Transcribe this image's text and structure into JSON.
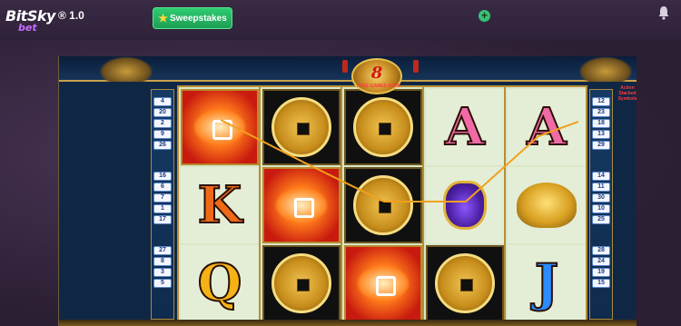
{
  "header": {
    "brand": "BitSky",
    "brand_sub": "bet",
    "version": "® 1.0",
    "sweepstakes_label": "Sweepstakes",
    "plus_icon": "plus-icon",
    "bell_icon": "bell-icon"
  },
  "game": {
    "free_games_count": "8",
    "free_games_text": "FREE GAMES WON!",
    "feature_label": "Action Stacked Symbols",
    "left_lines": [
      "4",
      "20",
      "2",
      "9",
      "26",
      "16",
      "6",
      "7",
      "1",
      "17",
      "27",
      "8",
      "3",
      "5"
    ],
    "right_lines": [
      "12",
      "23",
      "18",
      "13",
      "29",
      "14",
      "11",
      "30",
      "10",
      "25",
      "28",
      "24",
      "19",
      "15"
    ],
    "reels": [
      [
        "fortune",
        "K",
        "Q"
      ],
      [
        "coin",
        "fortune",
        "coin"
      ],
      [
        "coin",
        "coin",
        "fortune"
      ],
      [
        "A",
        "vase",
        "coin"
      ],
      [
        "A",
        "turtle",
        "J"
      ]
    ]
  }
}
